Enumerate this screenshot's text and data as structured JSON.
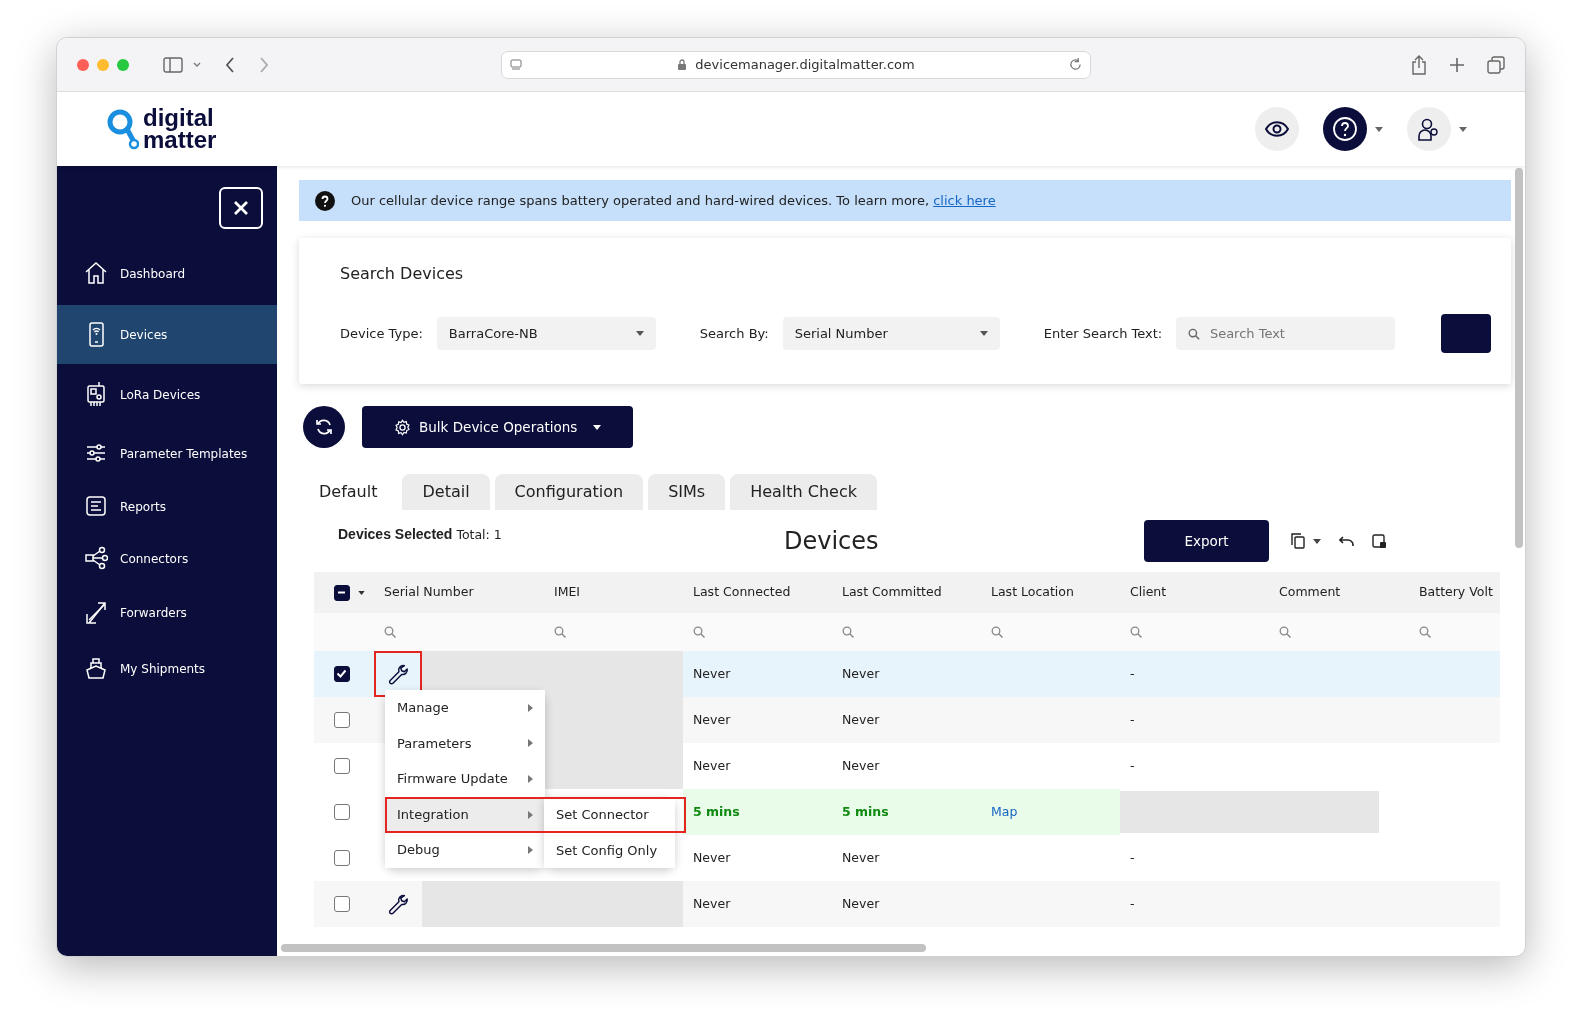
{
  "browser": {
    "url": "devicemanager.digitalmatter.com"
  },
  "brand": {
    "line1": "digital",
    "line2": "matter"
  },
  "sidebar": {
    "items": [
      {
        "label": "Dashboard",
        "selected": false
      },
      {
        "label": "Devices",
        "selected": true
      },
      {
        "label": "LoRa Devices",
        "selected": false
      },
      {
        "label": "Parameter Templates",
        "selected": false
      },
      {
        "label": "Reports",
        "selected": false
      },
      {
        "label": "Connectors",
        "selected": false
      },
      {
        "label": "Forwarders",
        "selected": false
      },
      {
        "label": "My Shipments",
        "selected": false
      }
    ]
  },
  "notice": {
    "text": "Our cellular device range spans battery operated and hard-wired devices. To learn more,",
    "link": "click here"
  },
  "search": {
    "title": "Search Devices",
    "fields": [
      {
        "label": "Device Type:",
        "kind": "select",
        "value": "BarraCore-NB"
      },
      {
        "label": "Search By:",
        "kind": "select",
        "value": "Serial Number"
      },
      {
        "label": "Enter Search Text:",
        "kind": "text",
        "placeholder": "Search Text"
      }
    ]
  },
  "bulk_button": "Bulk Device Operations",
  "tabs": [
    {
      "label": "Default",
      "selected": true
    },
    {
      "label": "Detail",
      "selected": false
    },
    {
      "label": "Configuration",
      "selected": false
    },
    {
      "label": "SIMs",
      "selected": false
    },
    {
      "label": "Health Check",
      "selected": false
    }
  ],
  "table": {
    "selected_label": "Devices Selected",
    "total": "Total: 1",
    "title": "Devices",
    "export": "Export",
    "header_checkbox_partial": true,
    "columns": [
      "Serial Number",
      "IMEI",
      "Last Connected",
      "Last Committed",
      "Last Location",
      "Client",
      "Comment",
      "Battery Volt"
    ],
    "rows": [
      {
        "checked": true,
        "kind": "plain",
        "wrench": true,
        "wrench_outlined": true,
        "serial_masked": true,
        "imei_masked": true,
        "client_masked": false,
        "last_connected": "Never",
        "last_committed": "Never",
        "last_location": "",
        "client": "-"
      },
      {
        "checked": false,
        "kind": "plain",
        "wrench": false,
        "wrench_outlined": false,
        "serial_masked": false,
        "imei_masked": true,
        "client_masked": false,
        "last_connected": "Never",
        "last_committed": "Never",
        "last_location": "",
        "client": "-"
      },
      {
        "checked": false,
        "kind": "plain",
        "wrench": false,
        "wrench_outlined": false,
        "serial_masked": false,
        "imei_masked": true,
        "client_masked": false,
        "last_connected": "Never",
        "last_committed": "Never",
        "last_location": "",
        "client": "-"
      },
      {
        "checked": false,
        "kind": "recent",
        "wrench": false,
        "wrench_outlined": false,
        "serial_masked": false,
        "imei_masked": false,
        "client_masked": true,
        "last_connected": "5 mins",
        "last_committed": "5 mins",
        "last_location": "Map",
        "client": ""
      },
      {
        "checked": false,
        "kind": "plain",
        "wrench": false,
        "wrench_outlined": false,
        "serial_masked": false,
        "imei_masked": false,
        "client_masked": false,
        "last_connected": "Never",
        "last_committed": "Never",
        "last_location": "",
        "client": "-"
      },
      {
        "checked": false,
        "kind": "plain",
        "wrench": true,
        "wrench_outlined": false,
        "serial_masked": true,
        "imei_masked": true,
        "client_masked": false,
        "last_connected": "Never",
        "last_committed": "Never",
        "last_location": "",
        "client": "-"
      }
    ]
  },
  "context_menu": {
    "items": [
      {
        "label": "Manage",
        "selected": false
      },
      {
        "label": "Parameters",
        "selected": false
      },
      {
        "label": "Firmware Update",
        "selected": false
      },
      {
        "label": "Integration",
        "selected": true
      },
      {
        "label": "Debug",
        "selected": false
      }
    ],
    "submenu": [
      {
        "label": "Set Connector",
        "outlined": true
      },
      {
        "label": "Set Config Only",
        "outlined": false
      }
    ]
  }
}
